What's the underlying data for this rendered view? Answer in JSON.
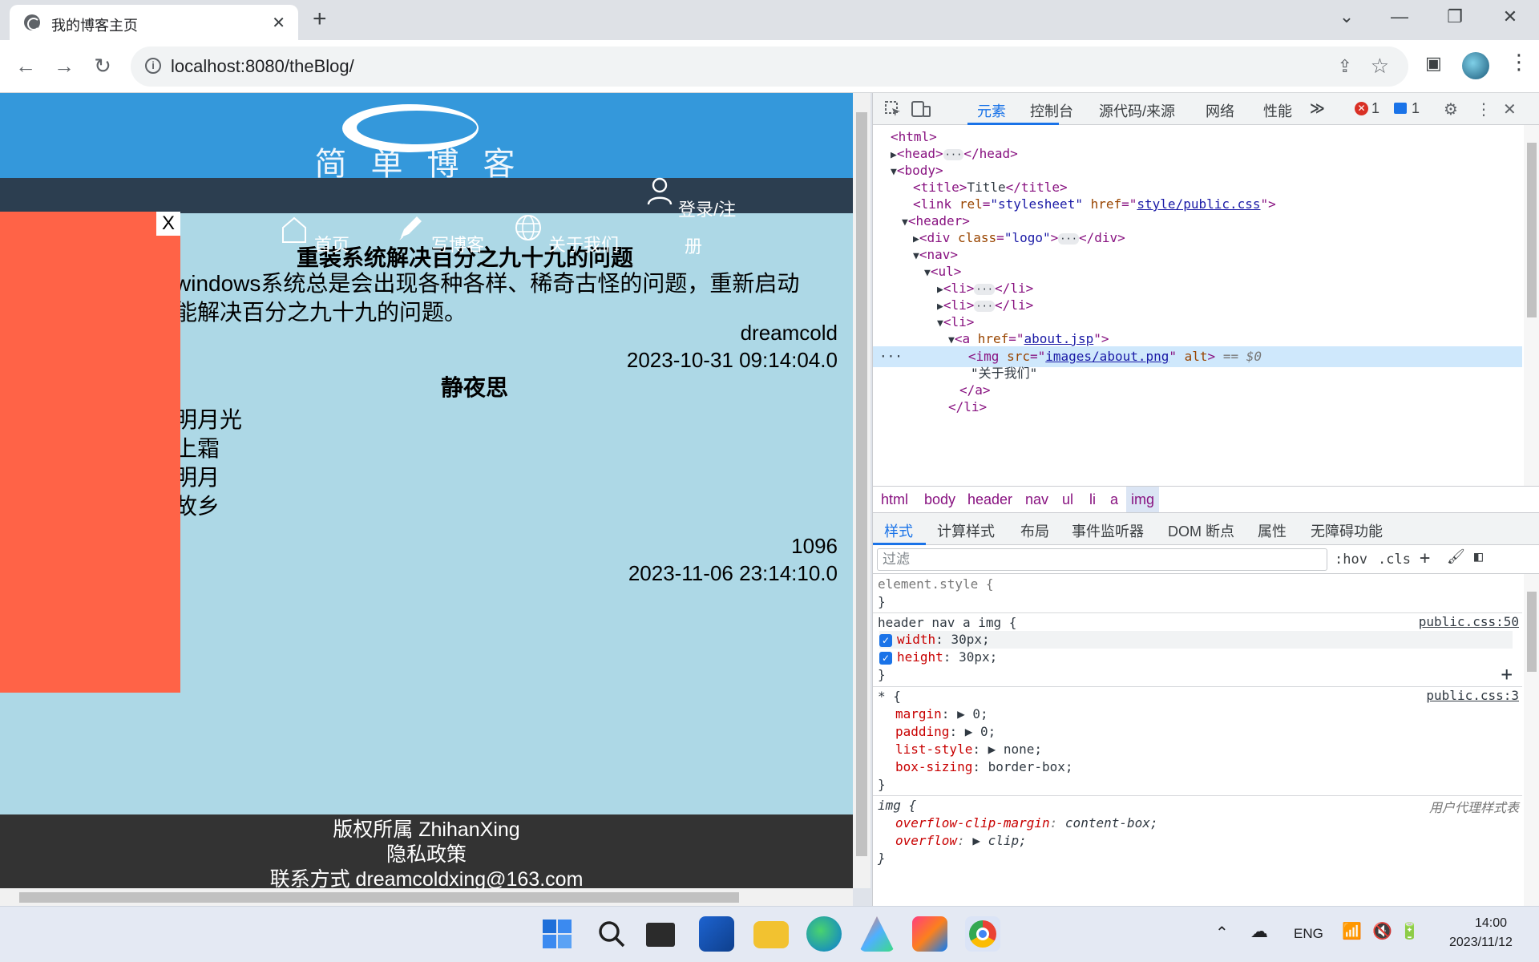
{
  "browser": {
    "tab_title": "我的博客主页",
    "tab_close": "✕",
    "new_tab": "+",
    "url": "localhost:8080/theBlog/",
    "window_buttons": [
      "⌄",
      "—",
      "❐",
      "✕"
    ],
    "nav_back": "←",
    "nav_forward": "→",
    "reload": "↻",
    "share": "⇪",
    "star": "☆",
    "sidebar_toggle": "▣",
    "menu": "⋮"
  },
  "site": {
    "logo_text": "简单博客",
    "nav": [
      "首页",
      "写博客",
      "关于我们"
    ],
    "login_line1": "登录/注",
    "login_line2": "册",
    "posts": [
      {
        "title": "重装系统解决百分之九十九的问题",
        "body": [
          "windows系统总是会出现各种各样、稀奇古怪的问题，重新启动",
          "能解决百分之九十九的问题。"
        ],
        "author": "dreamcold",
        "date": "2023-10-31 09:14:04.0"
      },
      {
        "title": "静夜思",
        "body": [
          "明月光",
          "上霜",
          "明月",
          "故乡"
        ],
        "author": "1096",
        "date": "2023-11-06 23:14:10.0"
      }
    ],
    "ad_close": "X",
    "footer": [
      "版权所属 ZhihanXing",
      "隐私政策",
      "联系方式 dreamcoldxing@163.com"
    ]
  },
  "devtools": {
    "tabs": [
      "元素",
      "控制台",
      "源代码/来源",
      "网络",
      "性能"
    ],
    "more_tabs": "≫",
    "errors": "1",
    "messages": "1",
    "breadcrumbs": [
      "html",
      "body",
      "header",
      "nav",
      "ul",
      "li",
      "a",
      "img"
    ],
    "style_tabs": [
      "样式",
      "计算样式",
      "布局",
      "事件监听器",
      "DOM 断点",
      "属性",
      "无障碍功能"
    ],
    "filter_placeholder": "过滤",
    "hov": ":hov",
    "cls": ".cls",
    "dom": {
      "html_open": "<html>",
      "head": "<head>",
      "head_close": "</head>",
      "body": "<body>",
      "title_open": "<title>",
      "title_text": "Title",
      "title_close": "</title>",
      "link_open": "<link",
      "rel_attr": "rel",
      "rel_val": "\"stylesheet\"",
      "href_attr": "href",
      "css_href": "style/public.css",
      "header": "<header>",
      "div_open": "<div",
      "class_attr": "class",
      "logo_val": "\"logo\"",
      "div_close": "</div>",
      "nav": "<nav>",
      "ul": "<ul>",
      "li_open": "<li>",
      "li_close": "</li>",
      "a_open": "<a",
      "about_href": "about.jsp",
      "img_open": "<img",
      "src_attr": "src",
      "img_src": "images/about.png",
      "alt_attr": "alt",
      "sel_marker": "== $0",
      "text_node": "\"关于我们\"",
      "a_close": "</a>"
    },
    "rules": {
      "element_style": "element.style {",
      "close_brace": "}",
      "r1_selector": "header nav a img {",
      "r1_source": "public.css:50",
      "r1_props": [
        {
          "name": "width",
          "value": "30px;"
        },
        {
          "name": "height",
          "value": "30px;"
        }
      ],
      "r2_selector": "* {",
      "r2_source": "public.css:3",
      "r2_props": [
        {
          "name": "margin",
          "value": "▶ 0;"
        },
        {
          "name": "padding",
          "value": "▶ 0;"
        },
        {
          "name": "list-style",
          "value": "▶ none;"
        },
        {
          "name": "box-sizing",
          "value": "border-box;"
        }
      ],
      "r3_selector": "img {",
      "r3_source": "用户代理样式表",
      "r3_props": [
        {
          "name": "overflow-clip-margin",
          "value": "content-box;"
        },
        {
          "name": "overflow",
          "value": "▶ clip;"
        }
      ]
    }
  },
  "taskbar": {
    "lang": "ENG",
    "time": "14:00",
    "date": "2023/11/12"
  },
  "colors": {
    "page_bg": "#add8e6",
    "site_header": "#3498db",
    "site_nav": "#2c3e50",
    "ad_banner": "#ff6347",
    "footer": "#333333",
    "devtools_accent": "#1a73e8"
  }
}
